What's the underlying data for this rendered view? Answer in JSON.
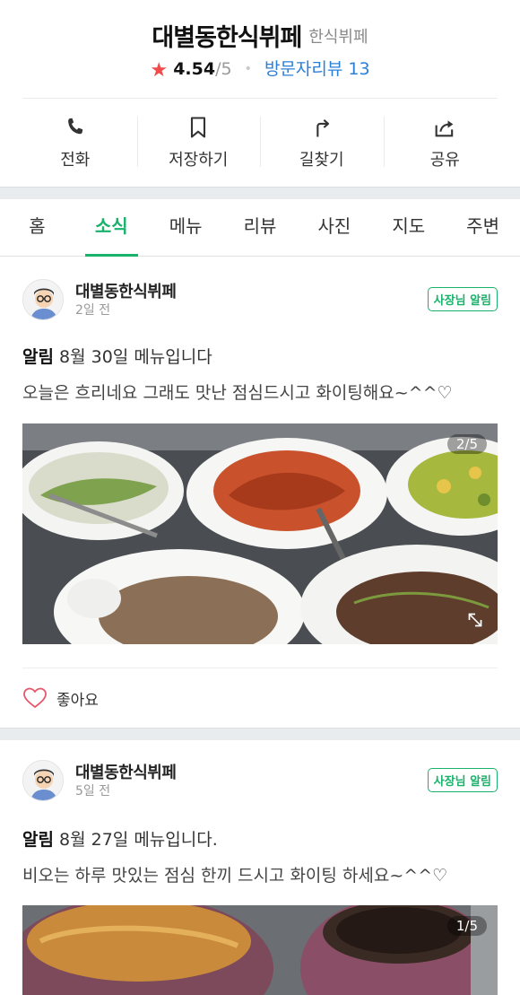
{
  "place": {
    "name": "대별동한식뷔페",
    "category": "한식뷔페",
    "rating_symbol": "★",
    "rating": "4.54",
    "rating_max": "/5",
    "visitor_reviews": "방문자리뷰 13"
  },
  "actions": [
    {
      "label": "전화",
      "icon": "phone-icon"
    },
    {
      "label": "저장하기",
      "icon": "bookmark-icon"
    },
    {
      "label": "길찾기",
      "icon": "directions-icon"
    },
    {
      "label": "공유",
      "icon": "share-icon"
    }
  ],
  "tabs": [
    {
      "label": "홈"
    },
    {
      "label": "소식",
      "active": true
    },
    {
      "label": "메뉴"
    },
    {
      "label": "리뷰"
    },
    {
      "label": "사진"
    },
    {
      "label": "지도"
    },
    {
      "label": "주변"
    }
  ],
  "posts": [
    {
      "author": "대별동한식뷔페",
      "time": "2일 전",
      "badge": "사장님 알림",
      "title_tag": "알림",
      "title": "8월 30일 메뉴입니다",
      "body": "오늘은 흐리네요 그래도 맛난 점심드시고 화이팅해요~^^♡",
      "photo_counter": "2/5",
      "like_label": "좋아요"
    },
    {
      "author": "대별동한식뷔페",
      "time": "5일 전",
      "badge": "사장님 알림",
      "title_tag": "알림",
      "title": "8월 27일 메뉴입니다.",
      "body": "비오는 하루 맛있는 점심 한끼 드시고 화이팅 하세요~^^♡",
      "photo_counter": "1/5"
    }
  ],
  "colors": {
    "accent": "#19b26b",
    "star": "#f04a4a",
    "link": "#2c7fd6"
  }
}
